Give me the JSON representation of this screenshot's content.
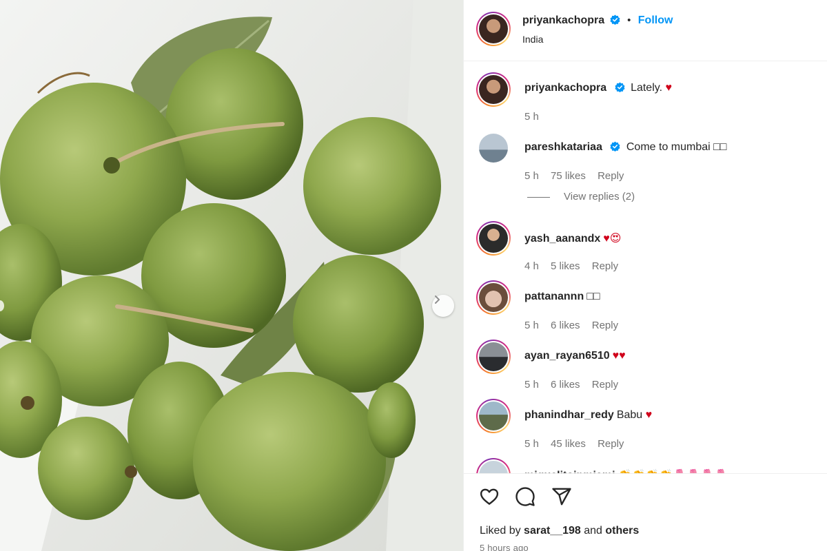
{
  "post": {
    "author": "priyankachopra",
    "location": "India",
    "follow_label": "Follow",
    "separator": "•",
    "liked_by_prefix": "Liked by",
    "liked_by_user": "sarat__198",
    "liked_by_and": "and",
    "liked_by_others": "others",
    "time_ago": "5 hours ago",
    "icons": [
      "heart-outline-icon",
      "comment-bubble-icon",
      "share-send-icon",
      "chevron-right-icon",
      "verified-badge-icon"
    ]
  },
  "comments": [
    {
      "user": "priyankachopra",
      "text": "Lately. ",
      "emoji": "♥",
      "time": "5 h",
      "likes": "",
      "reply": "",
      "verified": true
    },
    {
      "user": "pareshkatariaa",
      "text": "Come to mumbai ",
      "emoji": "□□",
      "time": "5 h",
      "likes": "75 likes",
      "reply": "Reply",
      "verified": true
    },
    {
      "user": "yash_aanandx",
      "text": "",
      "emoji": "♥😍",
      "time": "4 h",
      "likes": "5 likes",
      "reply": "Reply",
      "verified": false
    },
    {
      "user": "pattanannn",
      "text": "",
      "emoji": "□□",
      "time": "5 h",
      "likes": "6 likes",
      "reply": "Reply",
      "verified": false
    },
    {
      "user": "ayan_rayan6510",
      "text": "",
      "emoji": "♥♥",
      "time": "5 h",
      "likes": "6 likes",
      "reply": "Reply",
      "verified": false
    },
    {
      "user": "phanindhar_redy",
      "text": "Babu ",
      "emoji": "♥",
      "time": "5 h",
      "likes": "45 likes",
      "reply": "Reply",
      "verified": false
    },
    {
      "user": "miguelitoinmiami",
      "text": "",
      "emoji": "👏👏👏👏🌷🌷🌷🌷",
      "time": "",
      "likes": "",
      "reply": "",
      "verified": false
    }
  ],
  "view_replies": "View replies (2)",
  "colors": {
    "accent": "#0095f6",
    "heart": "#d0021b",
    "meta": "#737373",
    "guava": "#8aa24a"
  }
}
